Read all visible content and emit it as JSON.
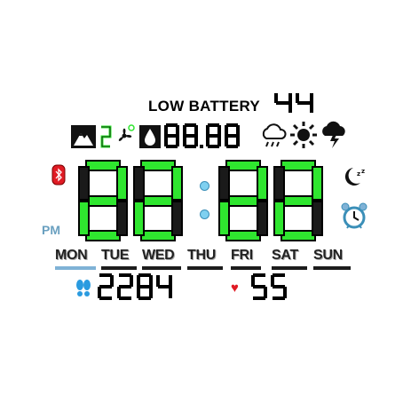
{
  "status": {
    "low_battery_label": "LOW BATTERY",
    "battery_level": "44"
  },
  "sensors": {
    "small_readout": "88.88"
  },
  "time": {
    "hours": "22",
    "minutes": "22",
    "meridiem": "PM"
  },
  "weekdays": {
    "items": [
      "MON",
      "TUE",
      "WED",
      "THU",
      "FRI",
      "SAT",
      "SUN"
    ],
    "active_index": 0
  },
  "health": {
    "steps": "2284",
    "heart_rate": "55"
  },
  "icons": {
    "activity": "mountain-icon",
    "fan": "fan-icon",
    "humidity": "droplet-icon",
    "weather_cloudy": "cloud-rain-icon",
    "weather_sunny": "sun-icon",
    "weather_storm": "storm-icon",
    "bluetooth": "bluetooth-icon",
    "sleep": "moon-sleep-icon",
    "alarm": "alarm-clock-icon",
    "steps": "footsteps-icon",
    "heart": "heart-icon"
  },
  "colors": {
    "segment_on": "#2fe62f",
    "segment_off": "#1a1a1a",
    "accent_blue": "#7fb2d6",
    "heart_red": "#e01b24"
  }
}
